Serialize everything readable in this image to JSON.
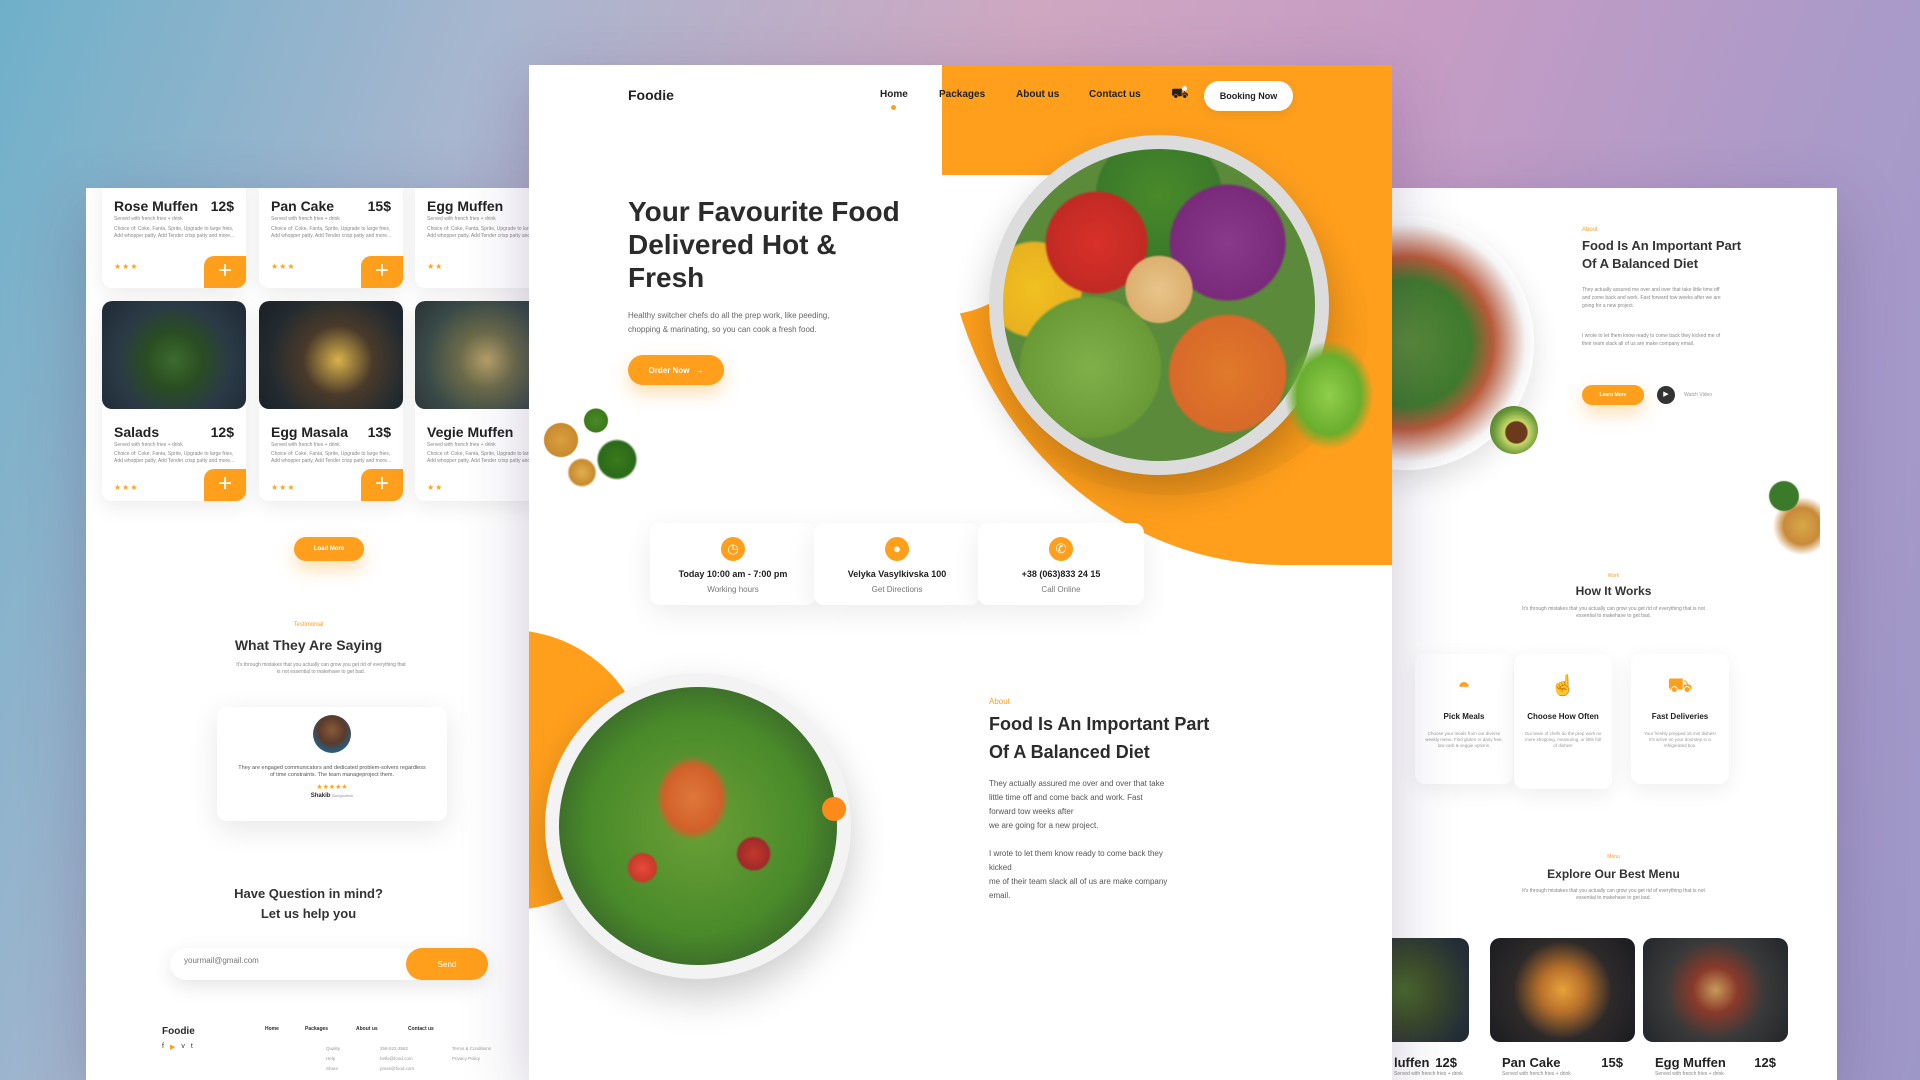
{
  "left": {
    "menu_cards_top": [
      {
        "name": "Rose Muffen",
        "price": "12$",
        "sub": "Served with french fries + drink",
        "desc": "Choice of: Coke, Fanta, Sprite, Upgrade to large fries, Add whopper patty, Add Tender crisp patty and more...",
        "stars": "★★★"
      },
      {
        "name": "Pan Cake",
        "price": "15$",
        "sub": "Served with french fries + drink",
        "desc": "Choice of: Coke, Fanta, Sprite, Upgrade to large fries, Add whopper patty, Add Tender crisp patty and more...",
        "stars": "★★★"
      },
      {
        "name": "Egg Muffen",
        "price": "",
        "sub": "Served with french fries + drink",
        "desc": "Choice of: Coke, Fanta, Sprite, Upgrade to large fries, Add whopper patty, Add Tender crisp patty and more...",
        "stars": "★★"
      }
    ],
    "menu_cards_bottom": [
      {
        "name": "Salads",
        "price": "12$",
        "sub": "Served with french fries + drink",
        "desc": "Choice of: Coke, Fanta, Sprite, Upgrade to large fries, Add whopper patty, Add Tender crisp patty and more...",
        "stars": "★★★"
      },
      {
        "name": "Egg Masala",
        "price": "13$",
        "sub": "Served with french fries + drink",
        "desc": "Choice of: Coke, Fanta, Sprite, Upgrade to large fries, Add whopper patty, Add Tender crisp patty and more...",
        "stars": "★★★"
      },
      {
        "name": "Vegie Muffen",
        "price": "",
        "sub": "Served with french fries + drink",
        "desc": "Choice of: Coke, Fanta, Sprite, Upgrade to large fries, Add whopper patty, Add Tender crisp patty and more...",
        "stars": "★★"
      }
    ],
    "add_label": "+",
    "load_more": "Load More",
    "testimonial_tag": "Testimonial",
    "testimonial_title": "What They Are Saying",
    "testimonial_sub": "It's through mistakes that you actually can grow you get rid of everything that is not essential to makehave to get bad.",
    "quote": "They are engaged communicators and dedicated problem-solvers regardless of time constraints. The team manageproject them.",
    "quote_stars": "★★★★★",
    "quote_author": "Shakib",
    "quote_location": "Bangladesh",
    "question_line1": "Have Question in mind?",
    "question_line2": "Let us help you",
    "email_placeholder": "yourmail@gmail.com",
    "send_label": "Send",
    "footer_logo": "Foodie",
    "footer_nav": [
      "Home",
      "Packages",
      "About us",
      "Contact us"
    ],
    "footer_links": [
      "Quality",
      "Help",
      "Share"
    ],
    "footer_contact": [
      "256-522-3562",
      "hello@food.com",
      "press@food.com"
    ],
    "footer_legal": [
      "Terms & Conditions",
      "Privacy Policy"
    ],
    "social_icons": [
      "f",
      "▶",
      "v",
      "t"
    ]
  },
  "center": {
    "logo": "Foodie",
    "nav": {
      "home": "Home",
      "packages": "Packages",
      "about": "About us",
      "contact": "Contact us"
    },
    "booking": "Booking Now",
    "hero_title_1": "Your Favourite Food",
    "hero_title_2": "Delivered Hot &",
    "hero_title_3": "Fresh",
    "hero_text_1": "Healthy switcher chefs do all the prep work, like peeding,",
    "hero_text_2": "chopping & marinating, so you can cook a fresh food.",
    "order_now": "Order Now",
    "order_arrow": "→",
    "info": [
      {
        "icon": "clock-icon",
        "glyph": "◷",
        "title": "Today 10:00 am - 7:00 pm",
        "sub": "Working hours"
      },
      {
        "icon": "location-pin-icon",
        "glyph": "●",
        "title": "Velyka Vasylkivska 100",
        "sub": "Get Directions"
      },
      {
        "icon": "phone-icon",
        "glyph": "✆",
        "title": "+38 (063)833 24 15",
        "sub": "Call Online"
      }
    ],
    "about_tag": "About",
    "about_title_1": "Food Is An Important Part",
    "about_title_2": "Of A Balanced Diet",
    "about_p1_1": "They actually assured me over and over that take",
    "about_p1_2": "little time off and come back and work. Fast",
    "about_p1_3": "forward tow weeks after",
    "about_p1_4": "we are going for a new project.",
    "about_p2_1": "I wrote to let them know ready to come back they",
    "about_p2_2": "kicked",
    "about_p2_3": "me of their team slack all of us are make company",
    "about_p2_4": "email."
  },
  "right": {
    "about_tag": "About",
    "about_title_1": "Food Is An Important Part",
    "about_title_2": "Of A Balanced Diet",
    "about_p1": "They actually assured me over and over that take little time off and come back and work. Fast forward tow weeks after we are going for a new project.",
    "about_p2": "I wrote to let them know ready to come back they kicked me of their team slack all of us are make company email.",
    "learn_more": "Learn More",
    "watch_video": "Watch Video",
    "work_tag": "Work",
    "work_title": "How It Works",
    "work_sub": "It's through mistakes that you actually can grow you get rid of everything that is not essential to makehave to get bad.",
    "steps": [
      {
        "icon": "roast-chicken-icon",
        "title": "Pick Meals",
        "desc": "Choose your meals from our diverse weekly menu. Find gluten or dairy free, low carb & veggie options."
      },
      {
        "icon": "hand-pointer-icon",
        "title": "Choose How Often",
        "desc": "Our team of chefs do the prep work no more shopping, measuring, or little full of dishes!"
      },
      {
        "icon": "delivery-truck-icon",
        "title": "Fast Deliveries",
        "desc": "Your freshly prepped 15 min dishes! It's arrive on your doorstep in a refrigerated box."
      }
    ],
    "menu_tag": "Menu",
    "menu_title": "Explore Our Best Menu",
    "menu_sub": "It's through mistakes that you actually can grow you get rid of everything that is not essential to makehave to get bad.",
    "menu_cards": [
      {
        "name": "luffen",
        "price": "12$",
        "sub": "Served with french fries + drink"
      },
      {
        "name": "Pan Cake",
        "price": "15$",
        "sub": "Served with french fries + drink"
      },
      {
        "name": "Egg Muffen",
        "price": "12$",
        "sub": "Served with french fries + drink"
      }
    ]
  },
  "colors": {
    "accent": "#ff9f1c",
    "text": "#2b2b2b",
    "muted": "#8a8a8a"
  }
}
